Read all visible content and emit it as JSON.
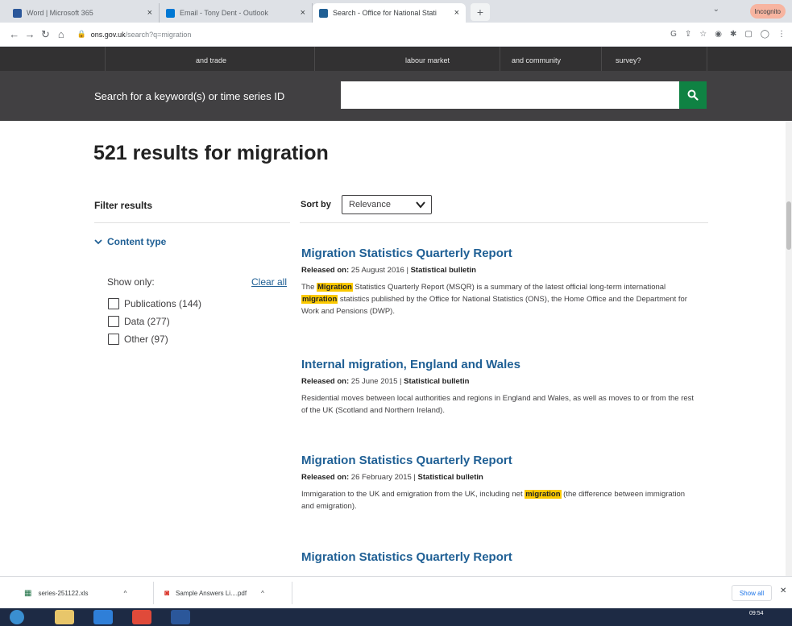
{
  "browser": {
    "tabs": [
      {
        "title": "Word | Microsoft 365",
        "favicon_color": "#2b579a"
      },
      {
        "title": "Email - Tony Dent - Outlook",
        "favicon_color": "#0078d4"
      },
      {
        "title": "Search - Office for National Stati",
        "favicon_color": "#206095"
      }
    ],
    "profile_label": "Incognito",
    "url_host": "ons.gov.uk",
    "url_path": "/search?q=migration"
  },
  "ons_nav": {
    "items": [
      "and trade",
      "labour market",
      "and community",
      "survey?"
    ]
  },
  "search": {
    "label": "Search for a keyword(s) or time series ID",
    "value": ""
  },
  "results": {
    "count": "521",
    "prefix": "results for",
    "query": "migration"
  },
  "filter": {
    "title": "Filter results",
    "section": "Content type",
    "show_only": "Show only:",
    "clear_all": "Clear all",
    "options": [
      {
        "label": "Publications (144)"
      },
      {
        "label": "Data (277)"
      },
      {
        "label": "Other (97)"
      }
    ]
  },
  "sort": {
    "label": "Sort by",
    "selected": "Relevance"
  },
  "items": [
    {
      "title": "Migration Statistics Quarterly Report",
      "released_label": "Released on:",
      "date": "25 August 2016",
      "type": "Statistical bulletin",
      "desc_a": "The ",
      "hl_a": "Migration",
      "desc_b": " Statistics Quarterly Report (MSQR) is a summary of the latest official long-term international ",
      "hl_b": "migration",
      "desc_c": " statistics published by the Office for National Statistics (ONS), the Home Office and the Department for Work and Pensions (DWP)."
    },
    {
      "title": "Internal migration, England and Wales",
      "released_label": "Released on:",
      "date": "25 June 2015",
      "type": "Statistical bulletin",
      "desc": "Residential moves between local authorities and regions in England and Wales, as well as moves to or from the rest of the UK (Scotland and Northern Ireland)."
    },
    {
      "title": "Migration Statistics Quarterly Report",
      "released_label": "Released on:",
      "date": "26 February 2015",
      "type": "Statistical bulletin",
      "desc_a": "Immigaration to the UK and emigration from the UK, including net ",
      "hl_a": "migration",
      "desc_b": " (the difference between immigration and emigration)."
    },
    {
      "title": "Migration Statistics Quarterly Report"
    }
  ],
  "downloads": {
    "items": [
      {
        "name": "series-251122.xls"
      },
      {
        "name": "Sample Answers Li....pdf"
      }
    ],
    "show_all": "Show all"
  },
  "taskbar": {
    "time": "09:54"
  },
  "colors": {
    "ons_blue": "#206095",
    "search_green": "#0f8243",
    "highlight": "#fbc900",
    "nav_dark": "#323132",
    "search_band": "#414042"
  }
}
